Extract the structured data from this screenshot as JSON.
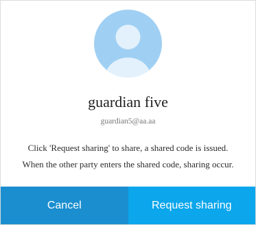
{
  "profile": {
    "name": "guardian five",
    "email": "guardian5@aa.aa",
    "avatar_icon": "user-avatar-icon",
    "avatar_bg": "#9fd0f3",
    "avatar_fg": "#e2f1fc"
  },
  "message": {
    "line1": "Click 'Request sharing' to share, a shared code is issued.",
    "line2": "When the other party enters the shared code, sharing occur."
  },
  "buttons": {
    "cancel_label": "Cancel",
    "request_label": "Request sharing",
    "cancel_color": "#1a8ecf",
    "request_color": "#0ba6ec"
  }
}
